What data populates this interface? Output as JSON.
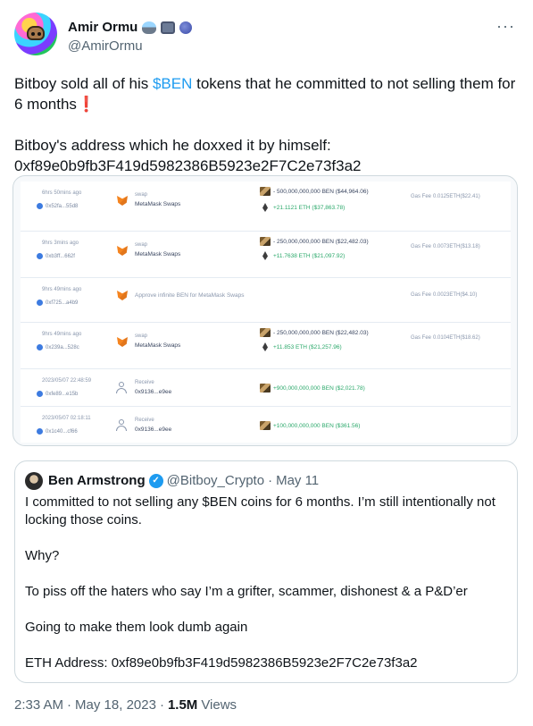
{
  "author": {
    "display_name": "Amir Ormu",
    "handle": "@AmirOrmu",
    "name_emojis": [
      "flying-saucer-icon",
      "floppy-disk-icon",
      "blueberries-icon"
    ]
  },
  "more_icon": "more-options-icon",
  "tweet": {
    "line1_before": "Bitboy sold all of his ",
    "cashtag": "$BEN",
    "line1_after": " tokens that he committed to not selling them for 6 months",
    "exclamation": "❗",
    "line2": "Bitboy's address which he doxxed it by himself:",
    "address": "0xf89e0b9fb3F419d5982386B5923e2F7C2e73f3a2"
  },
  "media": {
    "transactions": [
      {
        "time": "6hrs 50mins ago",
        "hash": "0x52fa...55d8",
        "type": "swap",
        "target": "MetaMask Swaps",
        "token_out": "- 500,000,000,000 BEN ($44,964.06)",
        "token_in": "+21.1121 ETH ($37,863.78)",
        "gas_label": "Gas Fee",
        "gas_value": "0.0125ETH($22.41)"
      },
      {
        "time": "9hrs 3mins ago",
        "hash": "0xb3ff...662f",
        "type": "swap",
        "target": "MetaMask Swaps",
        "token_out": "- 250,000,000,000 BEN ($22,482.03)",
        "token_in": "+11.7638 ETH ($21,097.92)",
        "gas_label": "Gas Fee",
        "gas_value": "0.0073ETH($13.18)"
      },
      {
        "time": "9hrs 49mins ago",
        "hash": "0xf725...a4b9",
        "approve": "Approve infinite BEN for MetaMask Swaps",
        "gas_label": "Gas Fee",
        "gas_value": "0.0023ETH($4.10)"
      },
      {
        "time": "9hrs 49mins ago",
        "hash": "0x239a...528c",
        "type": "swap",
        "target": "MetaMask Swaps",
        "token_out": "- 250,000,000,000 BEN ($22,482.03)",
        "token_in": "+11.853 ETH ($21,257.96)",
        "gas_label": "Gas Fee",
        "gas_value": "0.0104ETH($18.62)"
      },
      {
        "time": "2023/05/07 22:48:59",
        "hash": "0xfe89...e15b",
        "type": "Receive",
        "target": "0x9136...e9ee",
        "token_in": "+900,000,000,000 BEN ($2,021.78)"
      },
      {
        "time": "2023/05/07 02:18:11",
        "hash": "0x1c40...cf66",
        "type": "Receive",
        "target": "0x9136...e9ee",
        "token_in": "+100,000,000,000 BEN ($361.56)"
      }
    ]
  },
  "quote": {
    "name": "Ben Armstrong",
    "handle": "@Bitboy_Crypto",
    "separator": "·",
    "date": "May 11",
    "lines": [
      "I committed to not selling any $BEN coins for 6 months. I’m still intentionally not locking those coins.",
      "Why?",
      "To piss off the haters who say I’m a grifter, scammer, dishonest & a P&D’er",
      "Going to make them look dumb again",
      "ETH Address: 0xf89e0b9fb3F419d5982386B5923e2F7C2e73f3a2"
    ]
  },
  "footer": {
    "time": "2:33 AM",
    "date": "May 18, 2023",
    "separator": "·",
    "views_count": "1.5M",
    "views_label": "Views"
  }
}
